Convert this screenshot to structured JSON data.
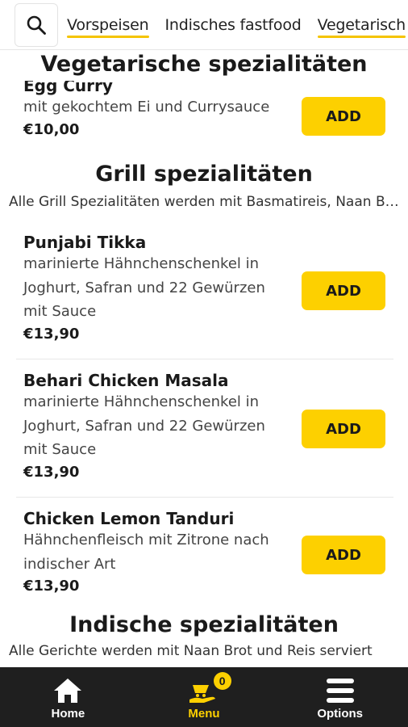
{
  "search": {
    "icon": "search-icon"
  },
  "tabs": [
    {
      "label": "Vorspeisen",
      "active": true
    },
    {
      "label": "Indisches fastfood",
      "active": false
    },
    {
      "label": "Vegetarisch",
      "active": true
    }
  ],
  "sticky_title": "Vegetarische spezialitäten",
  "partial_item": {
    "name": "Egg Curry",
    "description": "mit gekochtem Ei und Currysauce",
    "price": "€10,00",
    "add_label": "ADD"
  },
  "grill_section": {
    "title": "Grill spezialitäten",
    "subtitle": "Alle Grill Spezialitäten werden mit Basmatireis, Naan Brot und Salat serviert"
  },
  "grill_items": [
    {
      "name": "Punjabi Tikka",
      "description": "marinierte Hähnchenschenkel in Joghurt, Safran und 22 Gewürzen mit Sauce",
      "price": "€13,90",
      "add_label": "ADD"
    },
    {
      "name": "Behari Chicken Masala",
      "description": "marinierte Hähnchenschenkel in Joghurt, Safran und 22 Gewürzen mit Sauce",
      "price": "€13,90",
      "add_label": "ADD"
    },
    {
      "name": "Chicken Lemon Tanduri",
      "description": "Hähnchenfleisch mit Zitrone nach indischer Art",
      "price": "€13,90",
      "add_label": "ADD"
    }
  ],
  "indian_section": {
    "title": "Indische spezialitäten",
    "subtitle": "Alle Gerichte werden mit Naan Brot und Reis serviert"
  },
  "bottom_nav": {
    "home": {
      "label": "Home",
      "icon": "home-icon"
    },
    "menu": {
      "label": "Menu",
      "icon": "cart-hand-icon",
      "badge": "0"
    },
    "options": {
      "label": "Options",
      "icon": "hamburger-menu-icon"
    }
  },
  "colors": {
    "accent": "#fdd000",
    "nav_bg": "#1f1f1f",
    "text": "#1a1a1a"
  }
}
